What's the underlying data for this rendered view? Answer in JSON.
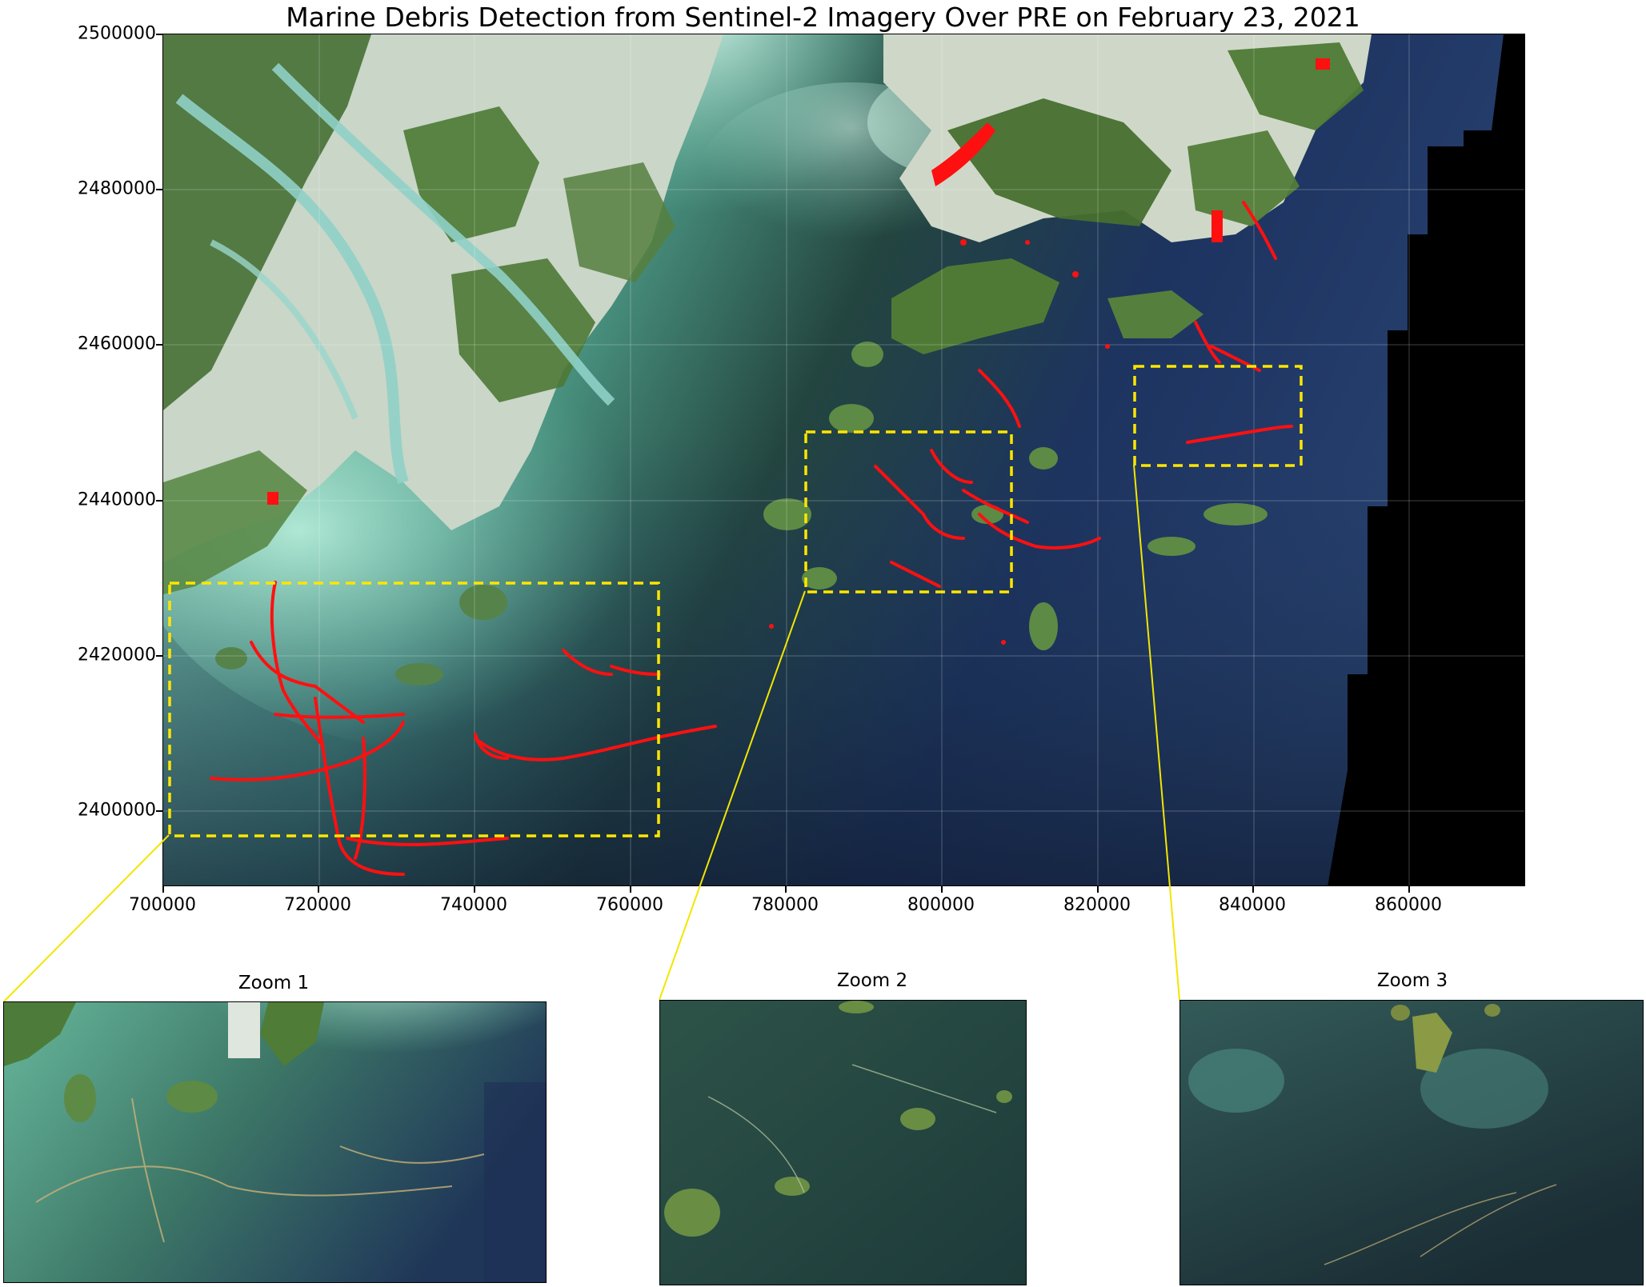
{
  "title": "Marine Debris Detection from Sentinel-2 Imagery Over PRE on February 23, 2021",
  "axes": {
    "x_ticks": [
      "700000",
      "720000",
      "740000",
      "760000",
      "780000",
      "800000",
      "820000",
      "840000",
      "860000"
    ],
    "y_ticks": [
      "2500000",
      "2480000",
      "2460000",
      "2440000",
      "2420000",
      "2400000"
    ]
  },
  "insets": [
    {
      "label": "Zoom 1"
    },
    {
      "label": "Zoom 2"
    },
    {
      "label": "Zoom 3"
    }
  ],
  "colors": {
    "debris": "#ff1010",
    "zoom_box": "#ffe600",
    "connector": "#f2e600",
    "land": "#3f6a2a",
    "turbid_water": "#86cfb8",
    "deep_water": "#1a2f55",
    "no_data": "#000000"
  }
}
